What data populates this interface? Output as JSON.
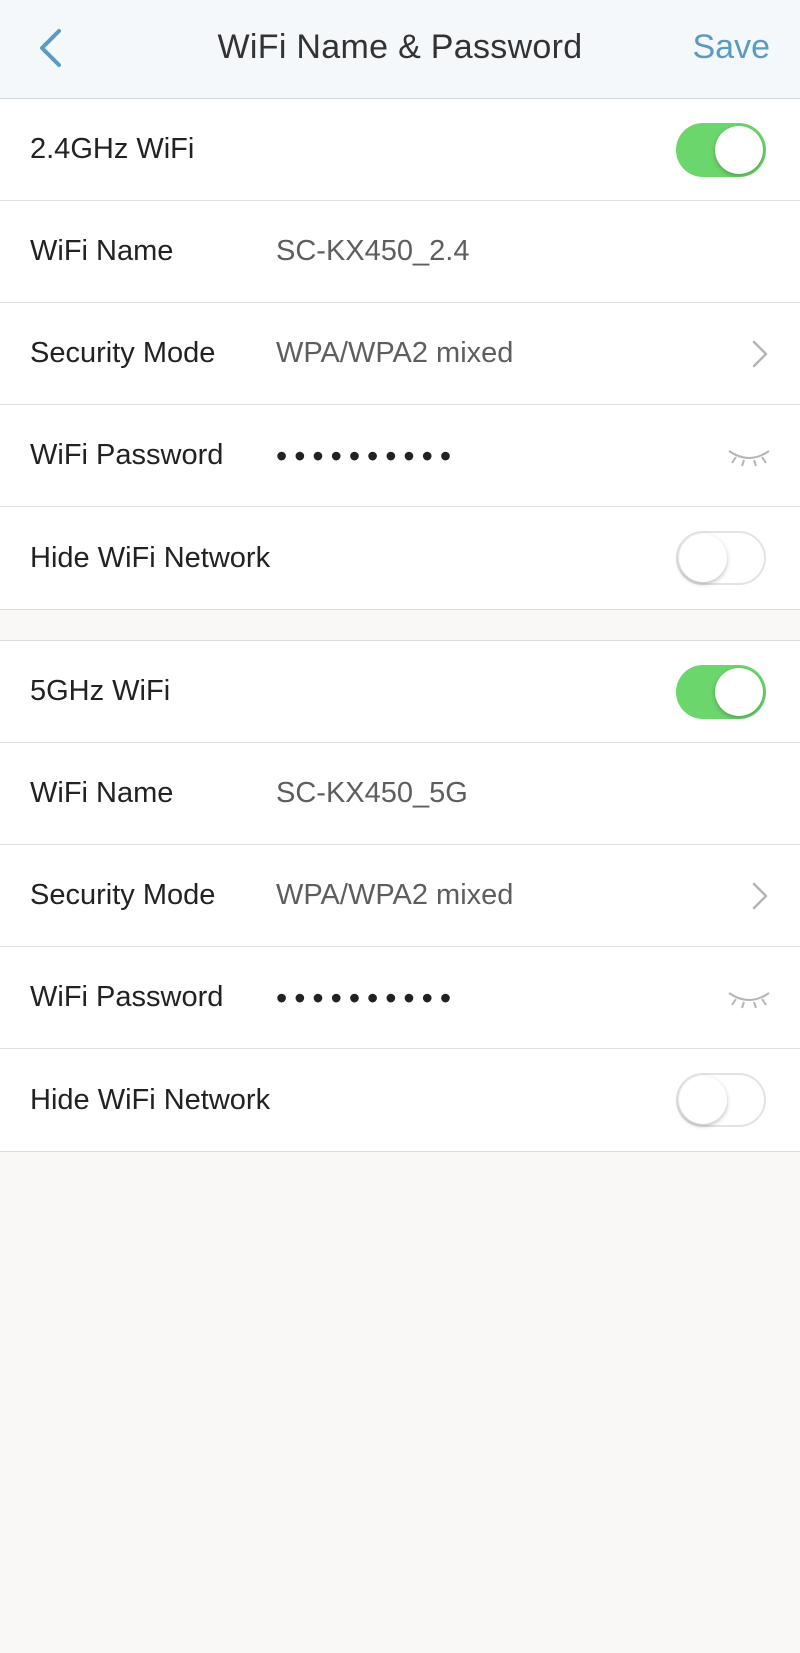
{
  "header": {
    "title": "WiFi Name & Password",
    "save_label": "Save"
  },
  "sections": [
    {
      "band_label": "2.4GHz WiFi",
      "enabled": true,
      "name_label": "WiFi Name",
      "name_value": "SC-KX450_2.4",
      "security_label": "Security Mode",
      "security_value": "WPA/WPA2 mixed",
      "password_label": "WiFi Password",
      "password_masked": "••••••••••",
      "hide_label": "Hide WiFi Network",
      "hide_enabled": false
    },
    {
      "band_label": "5GHz WiFi",
      "enabled": true,
      "name_label": "WiFi Name",
      "name_value": "SC-KX450_5G",
      "security_label": "Security Mode",
      "security_value": "WPA/WPA2 mixed",
      "password_label": "WiFi Password",
      "password_masked": "••••••••••",
      "hide_label": "Hide WiFi Network",
      "hide_enabled": false
    }
  ],
  "colors": {
    "accent": "#5a9bc0",
    "toggle_on": "#6bd66b"
  },
  "icons": [
    "back-arrow-icon",
    "chevron-right-icon",
    "eye-closed-icon"
  ]
}
